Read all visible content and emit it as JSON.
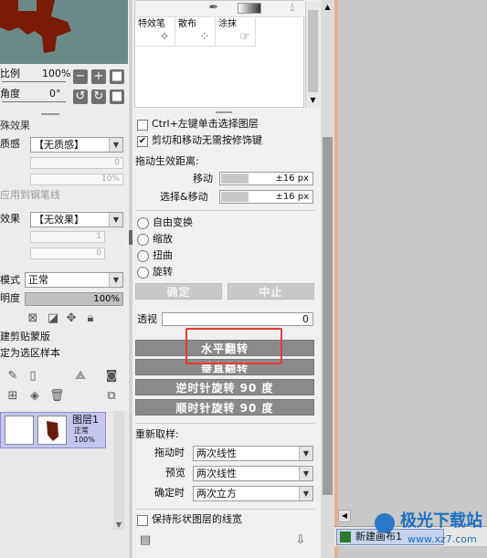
{
  "left": {
    "scale_label": "比例",
    "scale_value": "100%",
    "angle_label": "角度",
    "angle_value": "0°",
    "buttons": {
      "minus": "−",
      "plus": "+",
      "square": "■",
      "rot_ccw": "↺",
      "rot_cw": "↻",
      "square2": "■"
    },
    "special_effects_title": "殊效果",
    "texture_label": "质感",
    "texture_value": "【无质感】",
    "texture_num1": "0",
    "texture_num2": "10%",
    "apply_pen_label": "应用到钢笔线",
    "effect_label": "效果",
    "effect_value": "【无效果】",
    "effect_num1": "1",
    "effect_num2": "0",
    "mode_label": "模式",
    "mode_value": "正常",
    "opacity_label": "明度",
    "opacity_value": "100%",
    "clip_label": "建剪贴蒙版",
    "sample_label": "定为选区样本",
    "layer": {
      "name": "图层1",
      "mode": "正常",
      "opacity": "100%"
    }
  },
  "palette": {
    "tools": [
      "特效笔",
      "散布",
      "涂抹"
    ]
  },
  "options": {
    "ctrl_select": "Ctrl+左键单击选择图层",
    "cut_move": "剪切和移动无需按修饰键",
    "cut_move_checked": true,
    "drag_distance_title": "拖动生效距离:",
    "move_label": "移动",
    "move_value": "±16 px",
    "select_move_label": "选择&移动",
    "select_move_value": "±16 px"
  },
  "transform": {
    "free": "自由变换",
    "scale": "缩放",
    "distort": "扭曲",
    "rotate": "旋转",
    "ok": "确定",
    "cancel": "中止",
    "perspective_label": "透视",
    "perspective_value": "0",
    "hflip": "水平翻转",
    "vflip": "垂直翻转",
    "rot_ccw90": "逆时针旋转 90 度",
    "rot_cw90": "顺时针旋转 90 度"
  },
  "resample": {
    "title": "重新取样:",
    "drag_label": "拖动时",
    "drag_value": "两次线性",
    "preview_label": "预览",
    "preview_value": "两次线性",
    "confirm_label": "确定时",
    "confirm_value": "两次立方"
  },
  "keep_line": "保持形状图层的线宽",
  "canvas_tab": "新建画布1",
  "watermark": {
    "title": "极光下载站",
    "url": "www.xz7.com"
  },
  "colors": {
    "highlight": "#e53935",
    "gray_button": "#8a8a8a"
  }
}
